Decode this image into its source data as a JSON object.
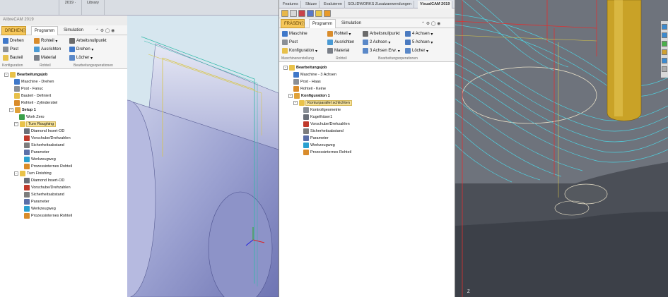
{
  "left": {
    "topstrip": [
      "2019 ·",
      "Library"
    ],
    "window_title": "AlibreCAM 2019",
    "tabs": [
      "DREHEN",
      "Programm",
      "Simulation"
    ],
    "ribbon": {
      "col1": [
        "Drehen",
        "Post",
        "Bauteil"
      ],
      "col2": [
        "Rohteil",
        "Ausrichten",
        "Material"
      ],
      "col3": [
        "Arbeitsnullpunkt",
        "Drehen",
        "Löcher"
      ],
      "groups": [
        "Konfiguration",
        "Rohteil",
        "Bearbeitungsoperationen"
      ]
    },
    "tree": [
      {
        "label": "Bearbeitungsjob",
        "level": 0,
        "bold": true,
        "exp": "-",
        "icon": "folder-icon"
      },
      {
        "label": "Maschine - Drehen",
        "level": 2,
        "icon": "machine-icon"
      },
      {
        "label": "Post - Fanuc",
        "level": 2,
        "icon": "post-icon"
      },
      {
        "label": "Bauteil - Definiert",
        "level": 2,
        "icon": "part-icon"
      },
      {
        "label": "Rohteil - Zylinderstiel",
        "level": 2,
        "icon": "stock-icon"
      },
      {
        "label": "Setup 1",
        "level": 1,
        "bold": true,
        "exp": "-",
        "icon": "setup-icon"
      },
      {
        "label": "Work Zero",
        "level": 3,
        "icon": "axis-icon"
      },
      {
        "label": "Turn Roughing",
        "level": 2,
        "sel": true,
        "exp": "-",
        "icon": "folder-icon"
      },
      {
        "label": "Diamond Insert-OD",
        "level": 4,
        "icon": "tool-icon"
      },
      {
        "label": "Vorschube/Drehzahlen",
        "level": 4,
        "icon": "feeds-icon"
      },
      {
        "label": "Sicherheitsabstand",
        "level": 4,
        "icon": "clearance-icon"
      },
      {
        "label": "Parameter",
        "level": 4,
        "icon": "parameter-icon"
      },
      {
        "label": "Werkzeugweg",
        "level": 4,
        "icon": "toolpath-icon"
      },
      {
        "label": "Prozessinternes Rohteil",
        "level": 4,
        "icon": "stock-icon"
      },
      {
        "label": "Turn Finishing",
        "level": 2,
        "exp": "-",
        "icon": "folder-icon"
      },
      {
        "label": "Diamond Insert-OD",
        "level": 4,
        "icon": "tool-icon"
      },
      {
        "label": "Vorschube/Drehzahlen",
        "level": 4,
        "icon": "feeds-icon"
      },
      {
        "label": "Sicherheitsabstand",
        "level": 4,
        "icon": "clearance-icon"
      },
      {
        "label": "Parameter",
        "level": 4,
        "icon": "parameter-icon"
      },
      {
        "label": "Werkzeugweg",
        "level": 4,
        "icon": "toolpath-icon"
      },
      {
        "label": "Prozessinternes Rohteil",
        "level": 4,
        "icon": "stock-icon"
      }
    ]
  },
  "middle": {
    "tabs": [
      "Features",
      "Skizze",
      "Evaluieren",
      "SOLIDWORKS Zusatzanwendungen",
      "VisualCAM 2019"
    ],
    "ribbon_tabs": [
      "FRÄSEN",
      "Programm",
      "Simulation"
    ],
    "ribbon": {
      "col1": [
        "Maschine",
        "Post",
        "Konfiguration"
      ],
      "col2": [
        "Rohteil",
        "Ausrichten",
        "Material"
      ],
      "col3": [
        "Arbeitsnullpunkt",
        "2 Achsen",
        "3 Achsen Erw."
      ],
      "col4": [
        "4 Achsen",
        "5 Achsen",
        "Löcher"
      ],
      "groups": [
        "Maschinenerstellung",
        "Rohteil",
        "Bearbeitungsoperationen"
      ]
    },
    "tree": [
      {
        "label": "Bearbeitungsjob",
        "level": 0,
        "bold": true,
        "exp": "-",
        "icon": "folder-icon"
      },
      {
        "label": "Maschine - 3 Achsen",
        "level": 2,
        "icon": "machine-icon"
      },
      {
        "label": "Post - Haas",
        "level": 2,
        "icon": "post-icon"
      },
      {
        "label": "Rohteil - Keine",
        "level": 2,
        "icon": "stock-icon"
      },
      {
        "label": "Konfiguration 1",
        "level": 1,
        "bold": true,
        "exp": "-",
        "icon": "setup-icon"
      },
      {
        "label": "Konturparallel schlichten",
        "level": 2,
        "sel": true,
        "exp": "-",
        "icon": "folder-icon"
      },
      {
        "label": "Kontrollgeometrie",
        "level": 4,
        "icon": "geometry-icon"
      },
      {
        "label": "Kugelfräser1",
        "level": 4,
        "icon": "tool-icon"
      },
      {
        "label": "Vorschube/Drehzahlen",
        "level": 4,
        "icon": "feeds-icon"
      },
      {
        "label": "Sicherheitsabstand",
        "level": 4,
        "icon": "clearance-icon"
      },
      {
        "label": "Parameter",
        "level": 4,
        "icon": "parameter-icon"
      },
      {
        "label": "Werkzeugweg",
        "level": 4,
        "icon": "toolpath-icon"
      },
      {
        "label": "Prozessinternes Rohteil",
        "level": 4,
        "icon": "stock-icon"
      }
    ]
  },
  "right": {
    "axis_label": "Z"
  },
  "colors": {
    "selection": "#f7e39a",
    "toolpath": "#4fd1e0",
    "tool": "#c9a227",
    "stock_edge": "#e03030"
  }
}
